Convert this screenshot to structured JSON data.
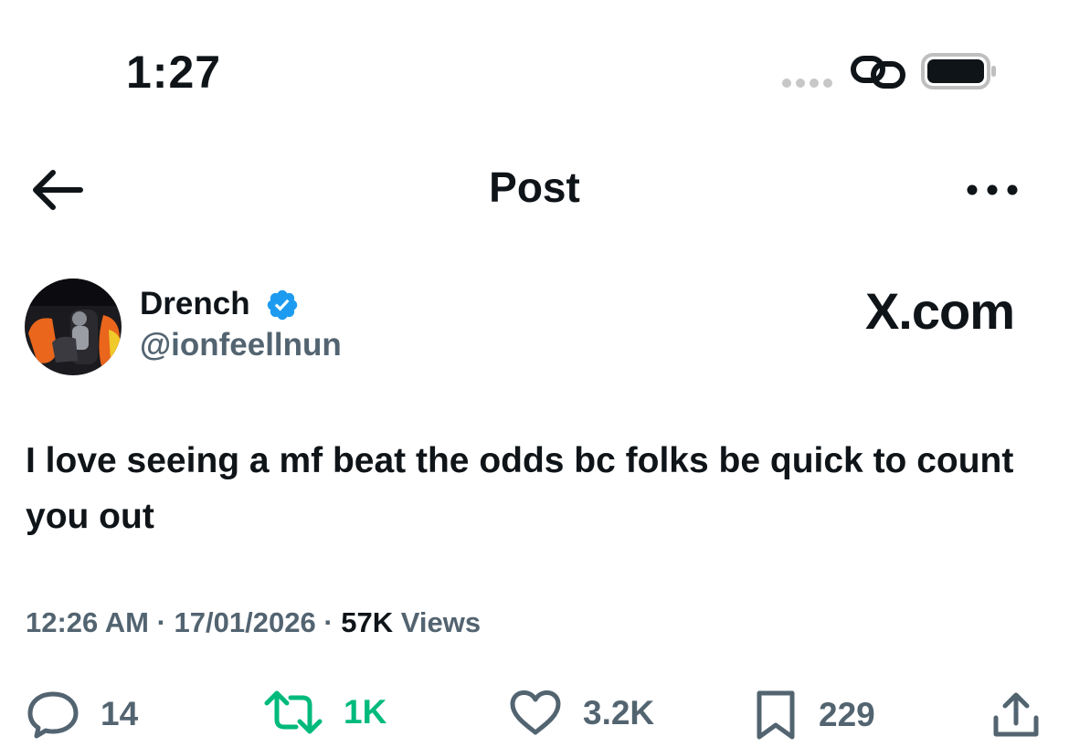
{
  "status_bar": {
    "time": "1:27"
  },
  "header": {
    "title": "Post"
  },
  "author": {
    "name": "Drench",
    "handle": "@ionfeellnun"
  },
  "watermark": "X.com",
  "tweet": {
    "text": "I love seeing a mf beat the odds bc folks be quick to count you out"
  },
  "meta": {
    "time": "12:26 AM",
    "date": "17/01/2026",
    "views_count": "57K",
    "views_label": "Views",
    "separator": "·"
  },
  "actions": {
    "replies": "14",
    "reposts": "1K",
    "likes": "3.2K",
    "bookmarks": "229"
  },
  "colors": {
    "text": "#0f1419",
    "secondary": "#536471",
    "repost_active": "#00ba7c",
    "verified": "#1d9bf0"
  },
  "icons": [
    "back-arrow-icon",
    "more-icon",
    "verified-badge-icon",
    "reply-icon",
    "repost-icon",
    "like-icon",
    "bookmark-icon",
    "share-icon",
    "link-icon",
    "battery-icon"
  ]
}
